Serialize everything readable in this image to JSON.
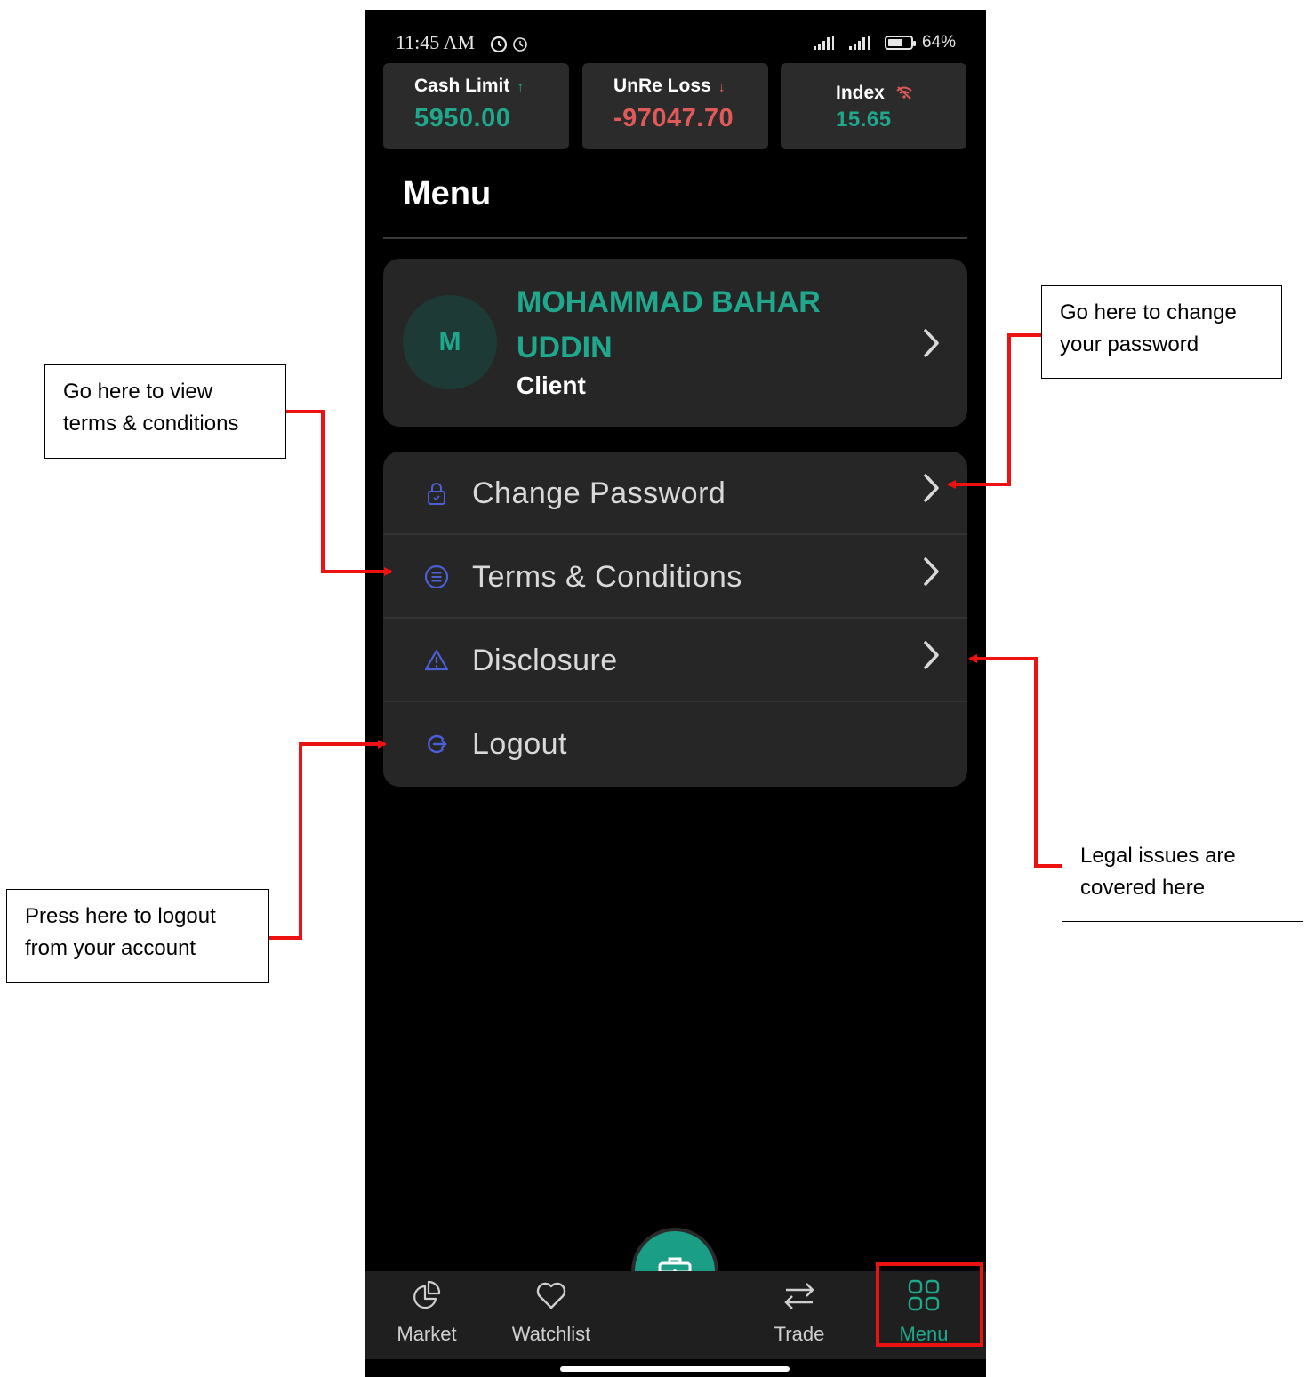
{
  "status_bar": {
    "time": "11:45 AM",
    "battery": "64%"
  },
  "stats": [
    {
      "label": "Cash Limit",
      "value": "5950.00",
      "trend": "up"
    },
    {
      "label": "UnRe Loss",
      "value": "-97047.70",
      "trend": "down"
    },
    {
      "label": "Index",
      "value": "15.65",
      "trend": "offline"
    }
  ],
  "page_title": "Menu",
  "profile": {
    "initial": "M",
    "name": "MOHAMMAD BAHAR UDDIN",
    "role": "Client"
  },
  "menu_items": [
    {
      "label": "Change Password",
      "icon": "lock-icon"
    },
    {
      "label": "Terms & Conditions",
      "icon": "list-circle-icon"
    },
    {
      "label": "Disclosure",
      "icon": "warning-icon"
    },
    {
      "label": "Logout",
      "icon": "logout-icon"
    }
  ],
  "bottom_nav": [
    {
      "label": "Market",
      "icon": "pie-chart-icon"
    },
    {
      "label": "Watchlist",
      "icon": "heart-icon"
    },
    {
      "label": "Trade",
      "icon": "swap-icon"
    },
    {
      "label": "Menu",
      "icon": "grid-icon",
      "active": true
    }
  ],
  "callouts": {
    "terms": "Go here to view terms & conditions",
    "password": "Go here to change your password",
    "logout": "Press here to logout from your account",
    "legal": "Legal issues are covered here"
  },
  "colors": {
    "accent": "#1fa88c",
    "negative": "#e05a5a",
    "icon_blue": "#4b5fd6",
    "annotation": "#ee1111"
  }
}
